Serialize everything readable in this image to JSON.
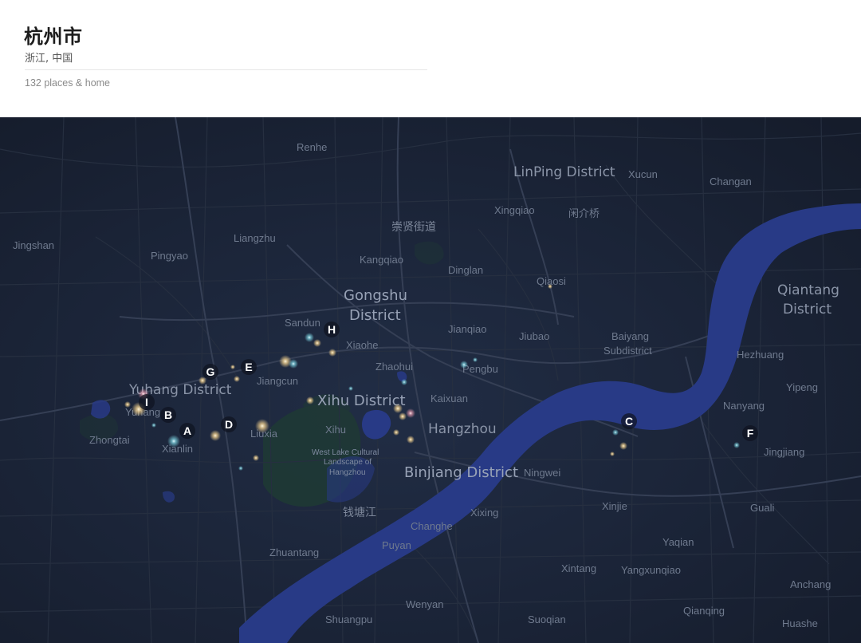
{
  "header": {
    "city": "杭州市",
    "region": "浙江, 中国",
    "places_summary": "132 places & home"
  },
  "map": {
    "theme": {
      "land": "#1b2536",
      "water": "#283a86",
      "park": "#1f3a34",
      "road": "#2c3647",
      "road_major": "#35405a"
    },
    "districts": {
      "linping": "LinPing District",
      "gongshu_1": "Gongshu",
      "gongshu_2": "District",
      "xihu": "Xihu District",
      "binjiang": "Binjiang District",
      "yuhang": "Yuhang District",
      "qiantang_1": "Qiantang",
      "qiantang_2": "District",
      "baiyang_1": "Baiyang",
      "baiyang_2": "Subdistrict",
      "hangzhou": "Hangzhou"
    },
    "places": {
      "renhe": "Renhe",
      "xucun": "Xucun",
      "changan": "Changan",
      "xingqiao": "Xingqiao",
      "chongxian": "崇贤街道",
      "yanjiao": "闲介桥",
      "jingshan": "Jingshan",
      "liangzhu": "Liangzhu",
      "pingyao": "Pingyao",
      "kangqiao": "Kangqiao",
      "dinglan": "Dinglan",
      "qiaosi": "Qiaosi",
      "sandun": "Sandun",
      "jianqiao": "Jianqiao",
      "jiubao": "Jiubao",
      "xiaohe": "Xiaohe",
      "hezhuang": "Hezhuang",
      "zhaohui": "Zhaohui",
      "pengbu": "Pengbu",
      "jiangcun": "Jiangcun",
      "yipeng": "Yipeng",
      "yuhang_town": "Yuhang",
      "kaixuan": "Kaixuan",
      "nanyang": "Nanyang",
      "zhongtai": "Zhongtai",
      "liuxia": "Liuxia",
      "xihu_area": "Xihu",
      "xianlin": "Xianlin",
      "jingjiang": "Jingjiang",
      "ningwei": "Ningwei",
      "qiantang_river_cn": "钱塘江",
      "xixing": "Xixing",
      "xinjie": "Xinjie",
      "guali": "Guali",
      "changhe": "Changhe",
      "puyan": "Puyan",
      "zhuantang": "Zhuantang",
      "yaqian": "Yaqian",
      "xintang": "Xintang",
      "yangxunqiao": "Yangxunqiao",
      "anchang": "Anchang",
      "wenyan": "Wenyan",
      "shuangpu": "Shuangpu",
      "suoqian": "Suoqian",
      "qianqing": "Qianqing",
      "huashe": "Huashe",
      "lake_1": "West Lake Cultural",
      "lake_2": "Landscape of",
      "lake_3": "Hangzhou"
    },
    "markers": {
      "a": "A",
      "b": "B",
      "c": "C",
      "d": "D",
      "e": "E",
      "f": "F",
      "g": "G",
      "h": "H",
      "i": "I"
    }
  }
}
